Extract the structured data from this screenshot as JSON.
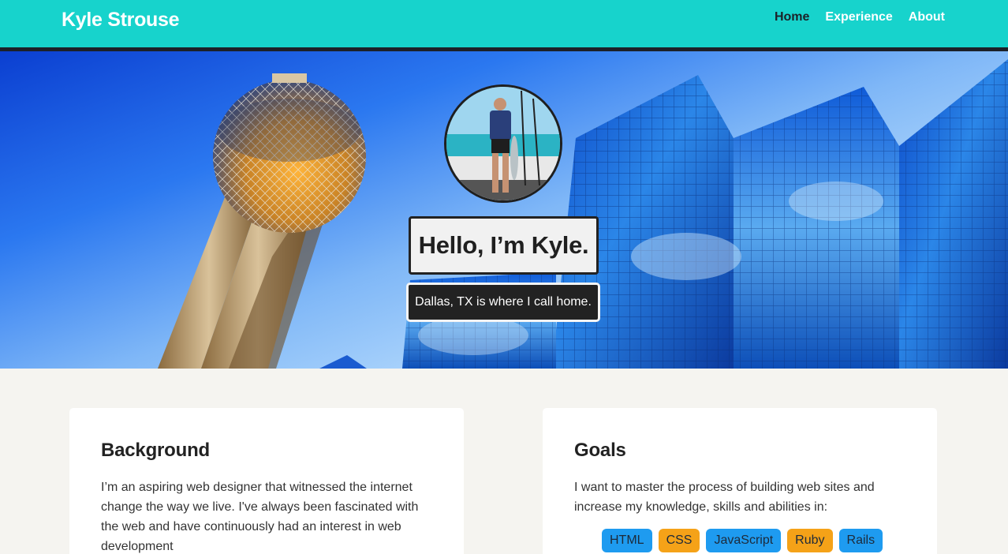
{
  "header": {
    "brand": "Kyle Strouse",
    "nav": [
      {
        "label": "Home",
        "active": true
      },
      {
        "label": "Experience",
        "active": false
      },
      {
        "label": "About",
        "active": false
      }
    ]
  },
  "hero": {
    "greeting": "Hello, I’m Kyle.",
    "tagline": "Dallas, TX is where I call home."
  },
  "background_card": {
    "title": "Background",
    "text": "I’m an aspiring web designer that witnessed the internet change the way we live. I've always been fascinated with the web and have continuously had an interest in web development"
  },
  "goals_card": {
    "title": "Goals",
    "text": "I want to master the process of building web sites and increase my knowledge, skills and abilities in:",
    "skills": [
      {
        "label": "HTML",
        "color": "#1e9bf0"
      },
      {
        "label": "CSS",
        "color": "#f5a218"
      },
      {
        "label": "JavaScript",
        "color": "#1e9bf0"
      },
      {
        "label": "Ruby",
        "color": "#f5a218"
      },
      {
        "label": "Rails",
        "color": "#1e9bf0"
      }
    ]
  },
  "colors": {
    "header_bg": "#17d3cc",
    "nav_active": "#1c2128",
    "page_bg": "#f5f4f0"
  }
}
